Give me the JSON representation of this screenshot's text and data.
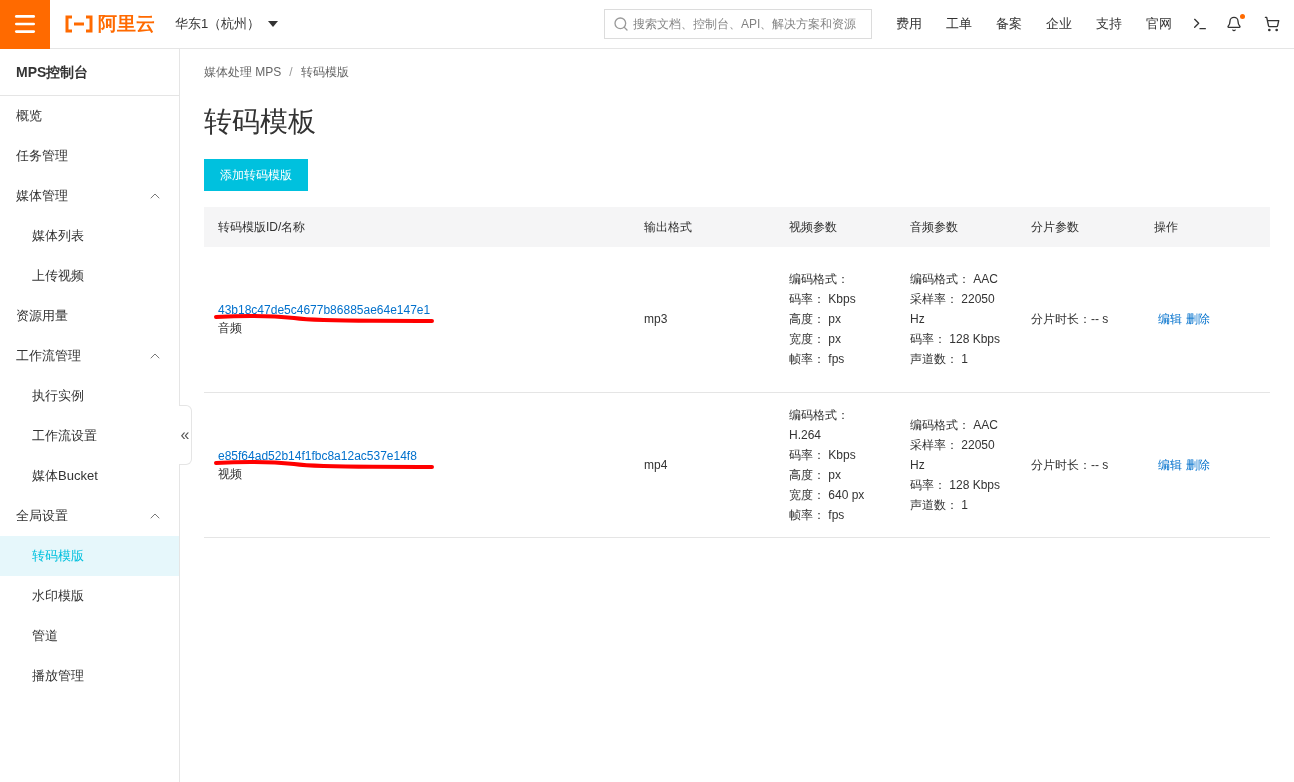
{
  "topbar": {
    "logo": "阿里云",
    "region": "华东1（杭州）",
    "search": {
      "placeholder": "搜索文档、控制台、API、解决方案和资源"
    },
    "links": [
      "费用",
      "工单",
      "备案",
      "企业",
      "支持",
      "官网"
    ],
    "notification_dot": true
  },
  "sidebar": {
    "title": "MPS控制台",
    "items": [
      {
        "label": "概览",
        "selected": false
      },
      {
        "label": "任务管理",
        "selected": false
      },
      {
        "label": "媒体管理",
        "selected": false,
        "expanded": true,
        "children": [
          {
            "label": "媒体列表",
            "selected": false
          },
          {
            "label": "上传视频",
            "selected": false
          }
        ]
      },
      {
        "label": "资源用量",
        "selected": false
      },
      {
        "label": "工作流管理",
        "selected": false,
        "expanded": true,
        "children": [
          {
            "label": "执行实例",
            "selected": false
          },
          {
            "label": "工作流设置",
            "selected": false
          },
          {
            "label": "媒体Bucket",
            "selected": false
          }
        ]
      },
      {
        "label": "全局设置",
        "selected": false,
        "expanded": true,
        "children": [
          {
            "label": "转码模版",
            "selected": true
          },
          {
            "label": "水印模版",
            "selected": false
          },
          {
            "label": "管道",
            "selected": false
          },
          {
            "label": "播放管理",
            "selected": false
          }
        ]
      }
    ],
    "collapse_handle": "«"
  },
  "breadcrumb": [
    "媒体处理 MPS",
    "转码模版"
  ],
  "breadcrumb_separator": "/",
  "page_title": "转码模板",
  "add_button": "添加转码模版",
  "table": {
    "columns": [
      "转码模版ID/名称",
      "输出格式",
      "视频参数",
      "音频参数",
      "分片参数",
      "操作"
    ],
    "rows": [
      {
        "id": "43b18c47de5c4677b86885ae64e147e1",
        "name": "音频",
        "format": "mp3",
        "video": [
          "编码格式：",
          "码率： Kbps",
          "高度： px",
          "宽度： px",
          "帧率： fps"
        ],
        "audio": [
          "编码格式： AAC",
          "采样率： 22050 Hz",
          "码率： 128 Kbps",
          "声道数： 1"
        ],
        "segment": "分片时长：-- s",
        "actions": [
          "编辑",
          "删除"
        ]
      },
      {
        "id": "e85f64ad52b14f1fbc8a12ac537e14f8",
        "name": "视频",
        "format": "mp4",
        "video": [
          "编码格式： H.264",
          "码率： Kbps",
          "高度： px",
          "宽度： 640 px",
          "帧率： fps"
        ],
        "audio": [
          "编码格式： AAC",
          "采样率： 22050 Hz",
          "码率： 128 Kbps",
          "声道数： 1"
        ],
        "segment": "分片时长：-- s",
        "actions": [
          "编辑",
          "删除"
        ]
      }
    ]
  }
}
